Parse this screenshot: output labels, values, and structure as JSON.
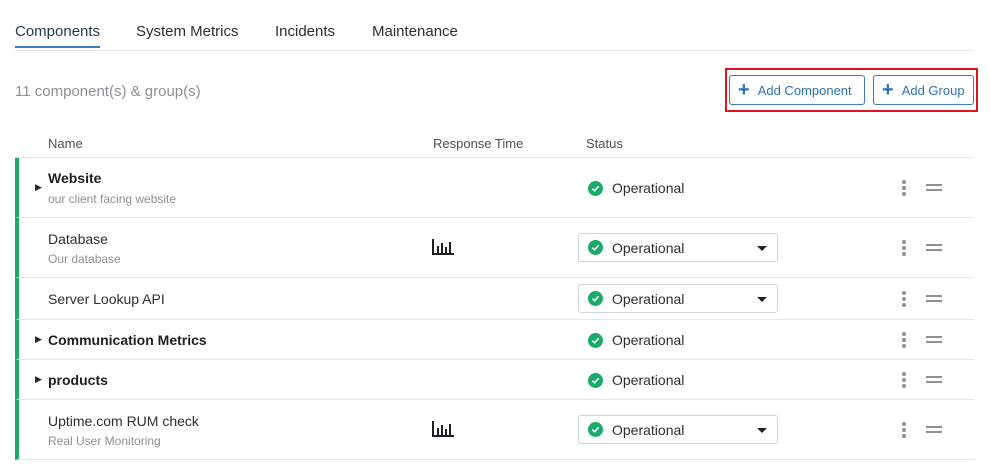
{
  "tabs": [
    {
      "label": "Components",
      "active": true
    },
    {
      "label": "System Metrics"
    },
    {
      "label": "Incidents"
    },
    {
      "label": "Maintenance"
    }
  ],
  "summary": {
    "count_text": "11 component(s) & group(s)"
  },
  "actions": {
    "add_component_label": "Add Component",
    "add_group_label": "Add Group"
  },
  "table": {
    "headers": {
      "name": "Name",
      "response_time": "Response Time",
      "status": "Status"
    },
    "rows": [
      {
        "name": "Website",
        "description": "our client facing website",
        "is_group": true,
        "status": "Operational",
        "has_chart": false
      },
      {
        "name": "Database",
        "description": "Our database",
        "is_group": false,
        "status": "Operational",
        "has_chart": true
      },
      {
        "name": "Server Lookup API",
        "description": "",
        "is_group": false,
        "status": "Operational",
        "has_chart": false
      },
      {
        "name": "Communication Metrics",
        "description": "",
        "is_group": true,
        "status": "Operational",
        "has_chart": false
      },
      {
        "name": "products",
        "description": "",
        "is_group": true,
        "status": "Operational",
        "has_chart": false
      },
      {
        "name": "Uptime.com RUM check",
        "description": "Real User Monitoring",
        "is_group": false,
        "status": "Operational",
        "has_chart": true
      }
    ]
  },
  "colors": {
    "accent": "#3b7bbf",
    "operational": "#1aab6a",
    "highlight": "#e0141e"
  },
  "icons": {
    "plus": "plus-icon",
    "status": "check-circle-icon",
    "chart": "bar-chart-icon",
    "menu": "kebab-menu-icon",
    "drag": "drag-handle-icon",
    "expand": "caret-right-icon",
    "dropdown": "chevron-down-icon"
  }
}
